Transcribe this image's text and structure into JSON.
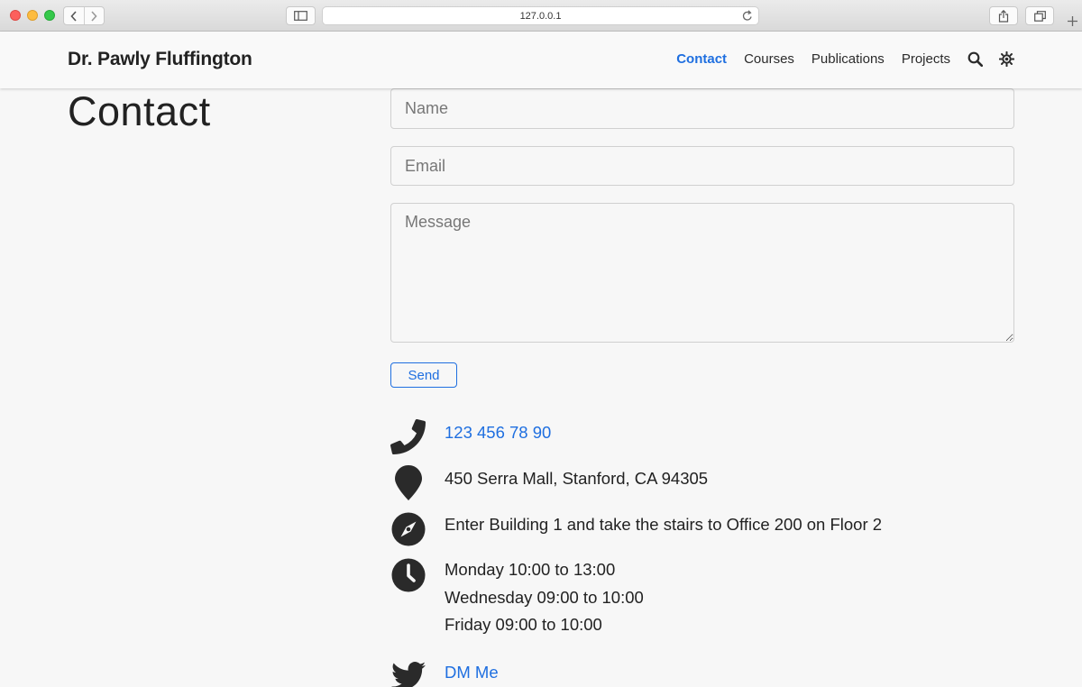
{
  "browser": {
    "url": "127.0.0.1",
    "icons": [
      "back-icon",
      "forward-icon",
      "sidebar-icon",
      "reload-icon",
      "share-icon",
      "tabs-icon",
      "plus-icon"
    ]
  },
  "navbar": {
    "brand": "Dr. Pawly Fluffington",
    "links": [
      {
        "label": "Contact",
        "active": true
      },
      {
        "label": "Courses",
        "active": false
      },
      {
        "label": "Publications",
        "active": false
      },
      {
        "label": "Projects",
        "active": false
      }
    ],
    "icons": [
      "search-icon",
      "theme-toggle-icon"
    ]
  },
  "page": {
    "title": "Contact"
  },
  "form": {
    "name_placeholder": "Name",
    "email_placeholder": "Email",
    "message_placeholder": "Message",
    "send_label": "Send"
  },
  "contact_info": {
    "phone": "123 456 78 90",
    "address": "450 Serra Mall, Stanford, CA 94305",
    "directions": "Enter Building 1 and take the stairs to Office 200 on Floor 2",
    "hours": [
      "Monday 10:00 to 13:00",
      "Wednesday 09:00 to 10:00",
      "Friday 09:00 to 10:00"
    ],
    "twitter_label": "DM Me"
  },
  "colors": {
    "accent": "#1f6fe0",
    "text": "#222222",
    "background": "#f7f7f7"
  }
}
